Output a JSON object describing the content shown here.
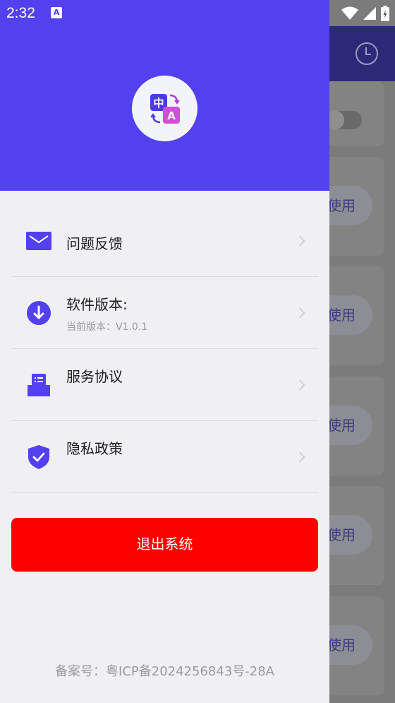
{
  "status_bar": {
    "time": "2:32",
    "notification_icon": "A"
  },
  "background_app": {
    "header_icon": "history-clock-icon",
    "use_button_label": "使用"
  },
  "drawer": {
    "logo_icon": "translate-icon",
    "logo_text_zh": "中",
    "logo_text_en": "A",
    "menu": [
      {
        "label": "问题反馈",
        "icon": "mail-icon"
      },
      {
        "label": "软件版本:",
        "sublabel": "当前版本：V1.0.1",
        "icon": "download-icon"
      },
      {
        "label": "服务协议",
        "icon": "document-tray-icon"
      },
      {
        "label": "隐私政策",
        "icon": "shield-check-icon"
      }
    ],
    "logout_label": "退出系统",
    "icp_text": "备案号：粤ICP备2024256843号-28A"
  },
  "colors": {
    "primary": "#5340ee",
    "danger": "#ff0000",
    "drawer_bg": "#f0f0f3"
  }
}
